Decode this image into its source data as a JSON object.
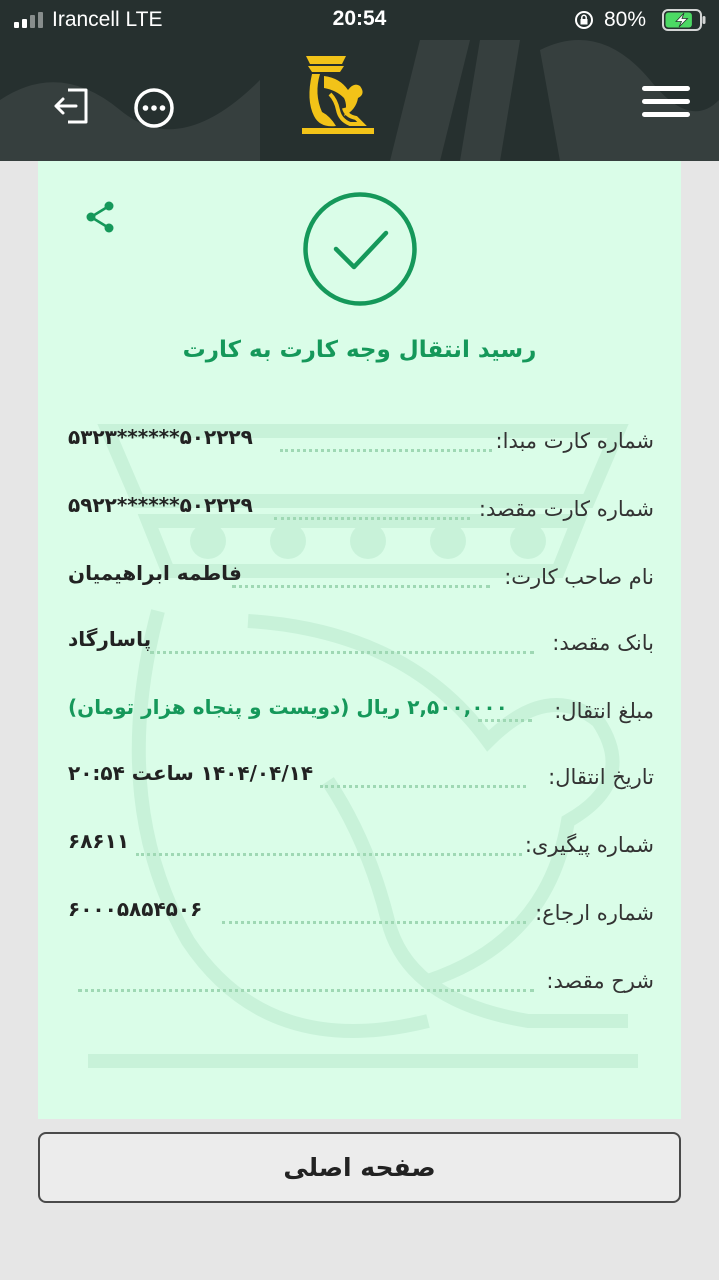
{
  "status_bar": {
    "carrier": "Irancell   LTE",
    "time": "20:54",
    "battery_percent": "80%",
    "battery_level": 0.8,
    "icons": [
      "signal-bars-icon",
      "orientation-lock-icon",
      "battery-charging-icon"
    ]
  },
  "header": {
    "icons": [
      "logout-icon",
      "more-options-icon",
      "bank-logo",
      "hamburger-menu-icon"
    ]
  },
  "receipt": {
    "title": "رسید انتقال وجه کارت به کارت",
    "rows": [
      {
        "label": "شماره کارت مبدا:",
        "value": "۵۰۲۲۲۹******۵۳۲۳"
      },
      {
        "label": "شماره کارت مقصد:",
        "value": "۵۰۲۲۲۹******۵۹۲۲"
      },
      {
        "label": "نام صاحب کارت:",
        "value": "فاطمه ابراهیمیان"
      },
      {
        "label": "بانک مقصد:",
        "value": "پاسارگاد"
      },
      {
        "label": "مبلغ انتقال:",
        "value": "۲,۵۰۰,۰۰۰ ریال (دویست و پنجاه هزار تومان)"
      },
      {
        "label": "تاریخ انتقال:",
        "value": "۱۴۰۴/۰۴/۱۴ ساعت ۲۰:۵۴"
      },
      {
        "label": "شماره پیگیری:",
        "value": "۶۸۶۱۱"
      },
      {
        "label": "شماره ارجاع:",
        "value": "۶۰۰۰۵۸۵۴۵۰۶"
      },
      {
        "label": "شرح مقصد:",
        "value": ""
      }
    ]
  },
  "home_button": {
    "label": "صفحه اصلی"
  },
  "colors": {
    "header_bg": "#26302f",
    "receipt_bg": "#dafde8",
    "accent_green": "#15985a",
    "logo_gold": "#f2c318",
    "page_bg": "#e6e6e6"
  }
}
